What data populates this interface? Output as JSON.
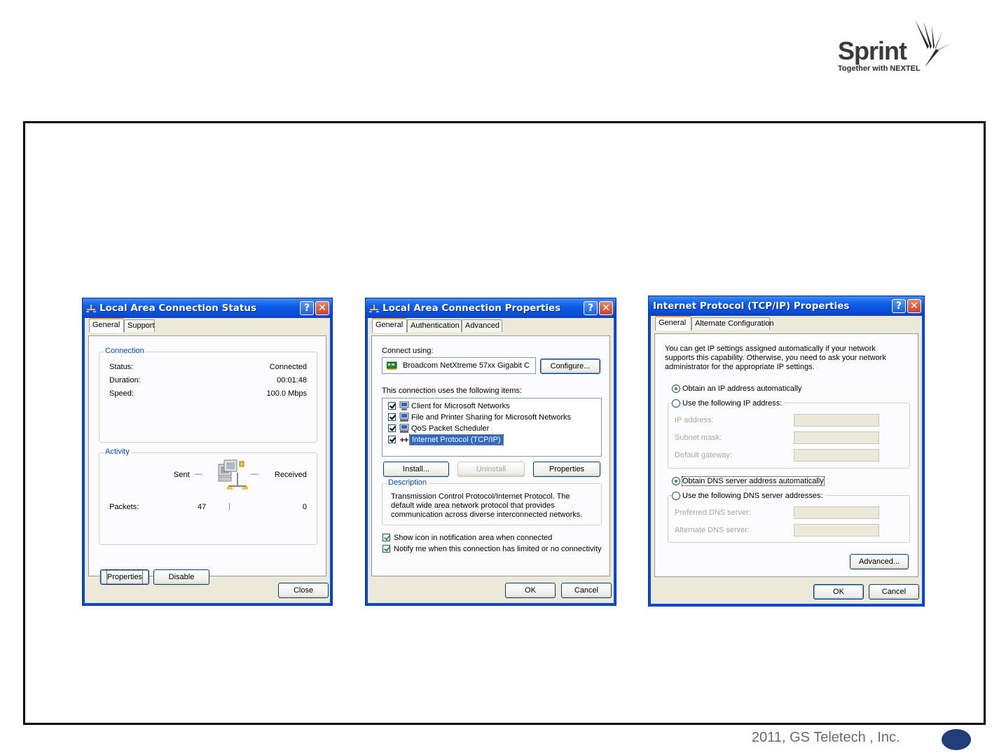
{
  "branding": {
    "logo_word": "Sprint",
    "logo_tagline": "Together with NEXTEL",
    "footer": "2011, GS Teletech , Inc."
  },
  "colors": {
    "titlebar": "#0a4ad8",
    "window_bg": "#ece9d8",
    "page_dot": "#1f3e7a"
  },
  "status_window": {
    "title": "Local Area Connection Status",
    "tabs": [
      "General",
      "Support"
    ],
    "connection_group": "Connection",
    "rows": [
      {
        "label": "Status:",
        "value": "Connected"
      },
      {
        "label": "Duration:",
        "value": "00:01:48"
      },
      {
        "label": "Speed:",
        "value": "100.0 Mbps"
      }
    ],
    "activity_group": "Activity",
    "sent": "Sent",
    "received": "Received",
    "packets_label": "Packets:",
    "packets_sent": "47",
    "packets_received": "0",
    "properties_btn": "Properties",
    "disable_btn": "Disable",
    "close_btn": "Close"
  },
  "properties_window": {
    "title": "Local Area Connection Properties",
    "tabs": [
      "General",
      "Authentication",
      "Advanced"
    ],
    "connect_using": "Connect using:",
    "adapter": "Broadcom NetXtreme 57xx Gigabit C",
    "configure_btn": "Configure...",
    "items_label": "This connection uses the following items:",
    "items": [
      "Client for Microsoft Networks",
      "File and Printer Sharing for Microsoft Networks",
      "QoS Packet Scheduler",
      "Internet Protocol (TCP/IP)"
    ],
    "install_btn": "Install...",
    "uninstall_btn": "Uninstall",
    "properties_btn": "Properties",
    "description_group": "Description",
    "description": "Transmission Control Protocol/Internet Protocol. The default wide area network protocol that provides communication across diverse interconnected networks.",
    "show_icon": "Show icon in notification area when connected",
    "notify": "Notify me when this connection has limited or no connectivity",
    "ok_btn": "OK",
    "cancel_btn": "Cancel"
  },
  "tcpip_window": {
    "title": "Internet Protocol (TCP/IP) Properties",
    "tabs": [
      "General",
      "Alternate Configuration"
    ],
    "intro": "You can get IP settings assigned automatically if your network supports this capability. Otherwise, you need to ask your network administrator for the appropriate IP settings.",
    "obtain_ip": "Obtain an IP address automatically",
    "use_ip": "Use the following IP address:",
    "ip_address": "IP address:",
    "subnet_mask": "Subnet mask:",
    "default_gateway": "Default gateway:",
    "obtain_dns": "Obtain DNS server address automatically",
    "use_dns": "Use the following DNS server addresses:",
    "preferred_dns": "Preferred DNS server:",
    "alternate_dns": "Alternate DNS server:",
    "advanced_btn": "Advanced...",
    "ok_btn": "OK",
    "cancel_btn": "Cancel"
  }
}
